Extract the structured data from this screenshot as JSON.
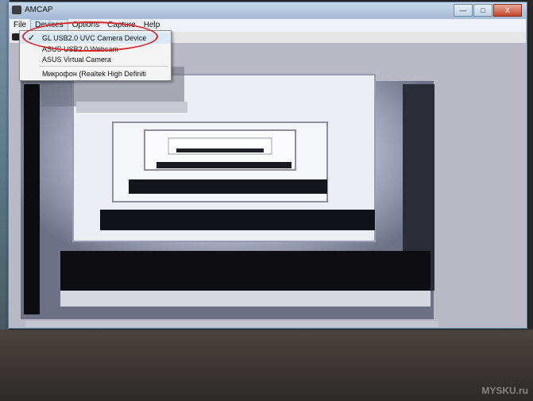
{
  "window": {
    "title": "AMCAP",
    "controls": [
      "—",
      "□",
      "X"
    ]
  },
  "menubar": {
    "items": [
      {
        "label": "File"
      },
      {
        "label": "Devices"
      },
      {
        "label": "Options"
      },
      {
        "label": "Capture"
      },
      {
        "label": "Help"
      }
    ]
  },
  "devices_menu": {
    "items": [
      {
        "label": "GL USB2.0 UVC Camera Device",
        "checked": true,
        "check_glyph": "✓"
      },
      {
        "label": "ASUS USB2.0 Webcam",
        "checked": false
      },
      {
        "label": "ASUS Virtual Camera",
        "checked": false
      },
      {
        "label": "Микрофон (Realtek High Definiti",
        "checked": false
      }
    ]
  },
  "watermark": "MYSKU.ru",
  "colors": {
    "highlight_ring": "#d8262a",
    "titlebar": "#b4c9de",
    "menu_active": "#d8e6f4"
  }
}
